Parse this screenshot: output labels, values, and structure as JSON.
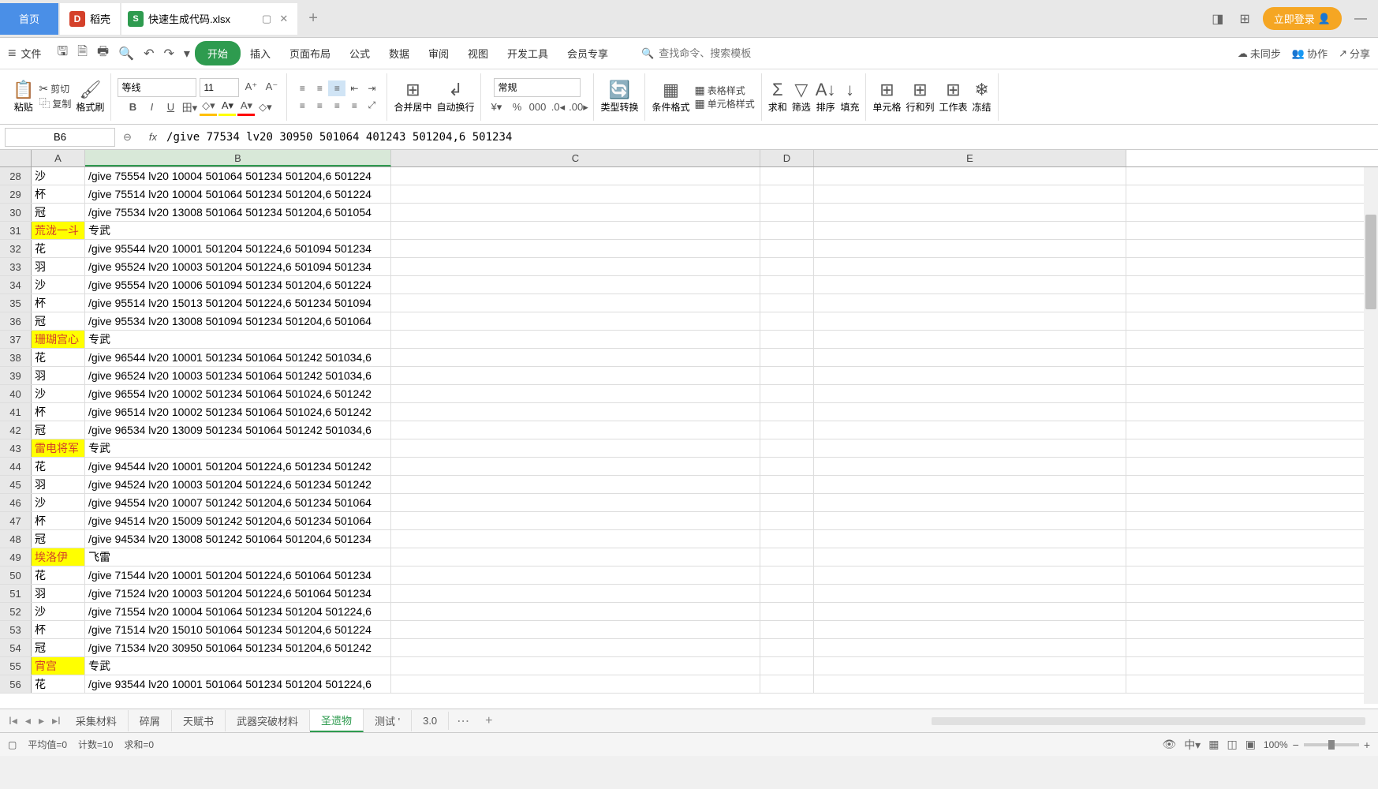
{
  "tabs": {
    "home": "首页",
    "doke": "稻壳",
    "file": "快速生成代码.xlsx"
  },
  "login": "立即登录",
  "menu": {
    "file": "文件",
    "start": "开始",
    "insert": "插入",
    "page": "页面布局",
    "formula": "公式",
    "data": "数据",
    "review": "审阅",
    "view": "视图",
    "dev": "开发工具",
    "member": "会员专享",
    "search_ph": "查找命令、搜索模板",
    "unsync": "未同步",
    "collab": "协作",
    "share": "分享"
  },
  "ribbon": {
    "paste": "粘贴",
    "cut": "剪切",
    "copy": "复制",
    "fmtpaint": "格式刷",
    "font": "等线",
    "size": "11",
    "merge": "合并居中",
    "wrap": "自动换行",
    "numfmt": "常规",
    "typeconv": "类型转换",
    "condfmt": "条件格式",
    "tblstyle": "表格样式",
    "cellstyle": "单元格样式",
    "sum": "求和",
    "filter": "筛选",
    "sort": "排序",
    "fill": "填充",
    "cellgrp": "单元格",
    "rowcol": "行和列",
    "worksheet": "工作表",
    "freeze": "冻结"
  },
  "namebox": "B6",
  "formula": "/give 77534 lv20 30950 501064 401243 501204,6 501234",
  "cols": [
    "A",
    "B",
    "C",
    "D",
    "E"
  ],
  "rows": [
    {
      "n": 28,
      "a": "沙",
      "b": "/give 75554 lv20 10004 501064 501234 501204,6 501224"
    },
    {
      "n": 29,
      "a": "杯",
      "b": "/give 75514 lv20 10004 501064 501234 501204,6 501224"
    },
    {
      "n": 30,
      "a": "冠",
      "b": "/give 75534 lv20 13008 501064 501234 501204,6 501054"
    },
    {
      "n": 31,
      "a": "荒泷一斗",
      "b": "专武",
      "ylw": true
    },
    {
      "n": 32,
      "a": "花",
      "b": "/give 95544 lv20 10001 501204 501224,6 501094 501234"
    },
    {
      "n": 33,
      "a": "羽",
      "b": "/give 95524 lv20 10003 501204 501224,6 501094 501234"
    },
    {
      "n": 34,
      "a": "沙",
      "b": "/give 95554 lv20 10006 501094 501234 501204,6 501224"
    },
    {
      "n": 35,
      "a": "杯",
      "b": "/give 95514 lv20 15013 501204 501224,6 501234 501094"
    },
    {
      "n": 36,
      "a": "冠",
      "b": "/give 95534 lv20 13008 501094 501234 501204,6 501064"
    },
    {
      "n": 37,
      "a": "珊瑚宫心",
      "b": "专武",
      "ylw": true
    },
    {
      "n": 38,
      "a": "花",
      "b": "/give 96544 lv20 10001 501234 501064 501242 501034,6"
    },
    {
      "n": 39,
      "a": "羽",
      "b": "/give 96524 lv20 10003 501234 501064 501242 501034,6"
    },
    {
      "n": 40,
      "a": "沙",
      "b": "/give 96554 lv20 10002 501234 501064 501024,6 501242"
    },
    {
      "n": 41,
      "a": "杯",
      "b": "/give 96514 lv20 10002 501234 501064 501024,6 501242"
    },
    {
      "n": 42,
      "a": "冠",
      "b": "/give 96534 lv20 13009 501234 501064 501242 501034,6"
    },
    {
      "n": 43,
      "a": "雷电将军",
      "b": "专武",
      "ylw": true
    },
    {
      "n": 44,
      "a": "花",
      "b": "/give 94544 lv20 10001 501204 501224,6 501234 501242"
    },
    {
      "n": 45,
      "a": "羽",
      "b": "/give 94524 lv20 10003 501204 501224,6 501234 501242"
    },
    {
      "n": 46,
      "a": "沙",
      "b": "/give 94554 lv20 10007 501242 501204,6 501234 501064"
    },
    {
      "n": 47,
      "a": "杯",
      "b": "/give 94514 lv20 15009 501242 501204,6 501234 501064"
    },
    {
      "n": 48,
      "a": "冠",
      "b": "/give 94534 lv20 13008 501242 501064 501204,6 501234"
    },
    {
      "n": 49,
      "a": "埃洛伊",
      "b": "飞雷",
      "ylw": true
    },
    {
      "n": 50,
      "a": "花",
      "b": "/give 71544 lv20 10001 501204 501224,6 501064 501234"
    },
    {
      "n": 51,
      "a": "羽",
      "b": "/give 71524 lv20 10003 501204 501224,6 501064 501234"
    },
    {
      "n": 52,
      "a": "沙",
      "b": "/give 71554 lv20 10004 501064 501234 501204 501224,6"
    },
    {
      "n": 53,
      "a": "杯",
      "b": "/give 71514 lv20 15010 501064 501234 501204,6 501224"
    },
    {
      "n": 54,
      "a": "冠",
      "b": "/give 71534 lv20 30950 501064 501234 501204,6 501242"
    },
    {
      "n": 55,
      "a": "宵宫",
      "b": "专武",
      "ylw": true
    },
    {
      "n": 56,
      "a": "花",
      "b": "/give 93544 lv20 10001 501064 501234 501204 501224,6"
    }
  ],
  "sheets": {
    "s1": "采集材料",
    "s2": "碎屑",
    "s3": "天赋书",
    "s4": "武器突破材料",
    "s5": "圣遗物",
    "s6": "测试  '",
    "s7": "3.0"
  },
  "status": {
    "avg": "平均值=0",
    "count": "计数=10",
    "sum": "求和=0",
    "zoom": "100%"
  }
}
